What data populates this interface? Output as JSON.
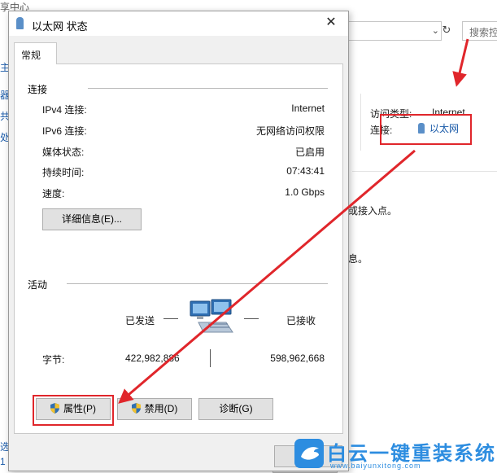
{
  "background": {
    "title_fragment": "享中心",
    "search_placeholder": "搜索控",
    "side_fragments": [
      "主",
      "器",
      "共",
      "处"
    ],
    "side_bottom_fragments": [
      "选",
      "1"
    ],
    "access_type_label": "访问类型:",
    "access_type_value": "Internet",
    "connection_label": "连接:",
    "connection_link": "以太网",
    "text_line_1": "或接入点。",
    "text_line_2": "息。"
  },
  "dialog": {
    "title": "以太网 状态",
    "close_label": "✕",
    "tab_general": "常规",
    "connection_group": "连接",
    "rows": [
      {
        "label": "IPv4 连接:",
        "value": "Internet"
      },
      {
        "label": "IPv6 连接:",
        "value": "无网络访问权限"
      },
      {
        "label": "媒体状态:",
        "value": "已启用"
      },
      {
        "label": "持续时间:",
        "value": "07:43:41"
      },
      {
        "label": "速度:",
        "value": "1.0 Gbps"
      }
    ],
    "details_button": "详细信息(E)...",
    "activity_group": "活动",
    "sent_label": "已发送",
    "received_label": "已接收",
    "bytes_label": "字节:",
    "bytes_sent": "422,982,886",
    "bytes_received": "598,962,668",
    "properties_button": "属性(P)",
    "disable_button": "禁用(D)",
    "diagnose_button": "诊断(G)"
  },
  "watermark": {
    "title": "白云一键重装系统",
    "url": "www.baiyunxitong.com"
  },
  "colors": {
    "highlight": "#e0262b",
    "link": "#1a5aa8",
    "watermark": "#2d8de0"
  }
}
